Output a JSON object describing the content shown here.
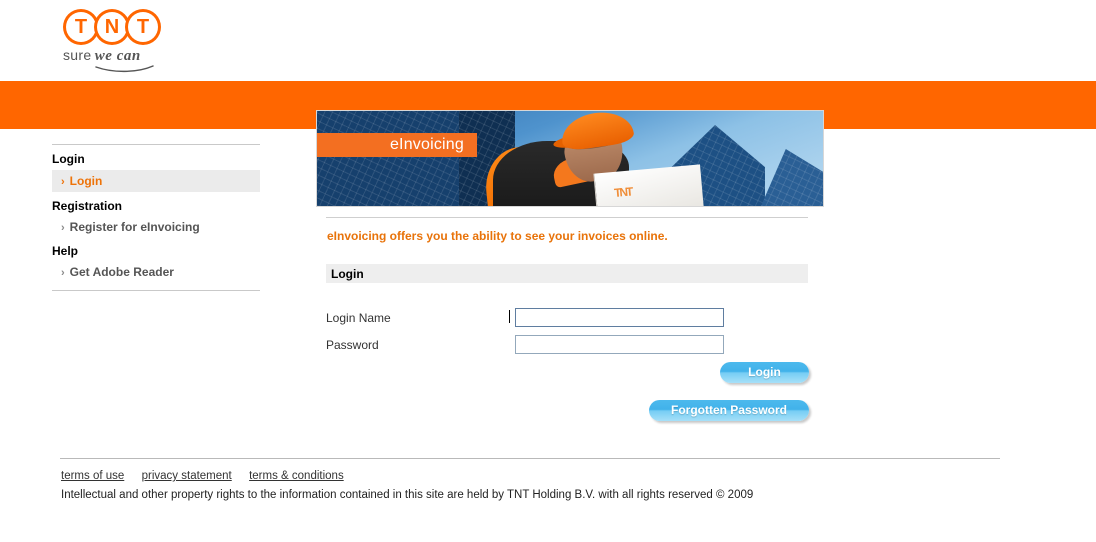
{
  "brand": {
    "logo_letters": [
      "T",
      "N",
      "T"
    ],
    "tagline_part1": "sure",
    "tagline_part2": "we can",
    "accent_orange": "#ff6600",
    "link_orange": "#ee7309",
    "button_blue": "#4cb9ed"
  },
  "sidebar": {
    "sections": [
      {
        "heading": "Login",
        "item": "Login",
        "active": true
      },
      {
        "heading": "Registration",
        "item": "Register for eInvoicing",
        "active": false
      },
      {
        "heading": "Help",
        "item": "Get Adobe Reader",
        "active": false
      }
    ],
    "chevron": "›"
  },
  "banner": {
    "label": "eInvoicing",
    "alt": "courier-with-parcel-photo"
  },
  "main": {
    "intro_text": "eInvoicing offers you the ability to see your invoices online.",
    "section_title": "Login",
    "fields": [
      {
        "label": "Login Name",
        "value": "",
        "placeholder": "",
        "focused": true
      },
      {
        "label": "Password",
        "value": "",
        "placeholder": "",
        "focused": false
      }
    ],
    "buttons": {
      "login": "Login",
      "forgotten_password": "Forgotten Password"
    }
  },
  "footer": {
    "links": [
      "terms of use",
      "privacy statement",
      "terms & conditions"
    ],
    "copyright": "Intellectual and other property rights to the information contained in this site are held by TNT Holding B.V. with all rights reserved © 2009"
  }
}
